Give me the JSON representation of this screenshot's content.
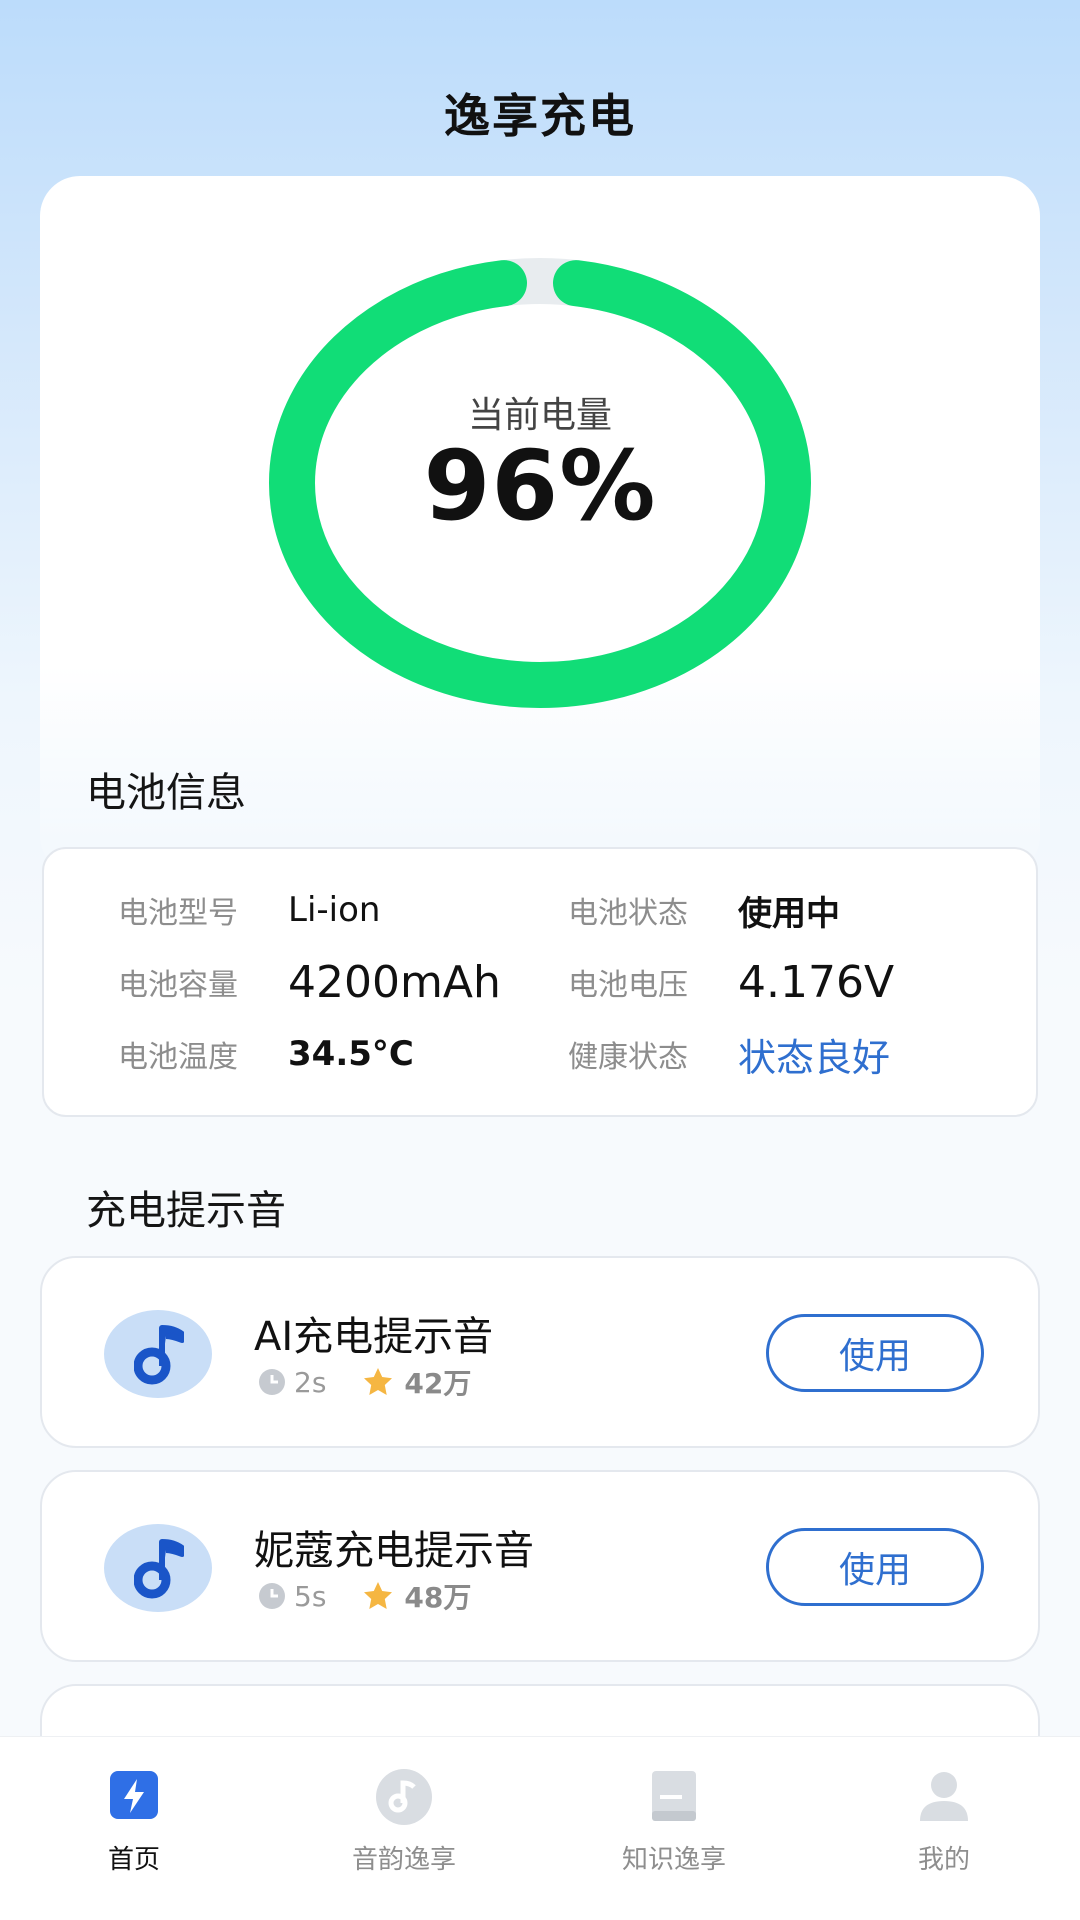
{
  "app": {
    "title": "逸享充电"
  },
  "battery_gauge": {
    "label": "当前电量",
    "value_text": "96%",
    "level": 0.96,
    "ring_color": "#11dd77"
  },
  "battery_info": {
    "section_title": "电池信息",
    "model": {
      "key": "电池型号",
      "value": "Li-ion"
    },
    "status": {
      "key": "电池状态",
      "value": "使用中"
    },
    "capacity": {
      "key": "电池容量",
      "value": "4200mAh"
    },
    "voltage": {
      "key": "电池电压",
      "value": "4.176V"
    },
    "temp": {
      "key": "电池温度",
      "value": "34.5°C"
    },
    "health": {
      "key": "健康状态",
      "value": "状态良好"
    }
  },
  "sounds": {
    "section_title": "充电提示音",
    "items": [
      {
        "name": "AI充电提示音",
        "duration": "2s",
        "plays": "42万",
        "button": "使用"
      },
      {
        "name": "妮蔻充电提示音",
        "duration": "5s",
        "plays": "48万",
        "button": "使用"
      }
    ]
  },
  "nav": {
    "items": [
      {
        "label": "首页",
        "icon": "lightning-icon",
        "active": true
      },
      {
        "label": "音韵逸享",
        "icon": "music-disc-icon",
        "active": false
      },
      {
        "label": "知识逸享",
        "icon": "book-icon",
        "active": false
      },
      {
        "label": "我的",
        "icon": "user-icon",
        "active": false
      }
    ]
  },
  "colors": {
    "accent": "#2f6fcf",
    "ring": "#11dd77",
    "star": "#f5b642"
  }
}
